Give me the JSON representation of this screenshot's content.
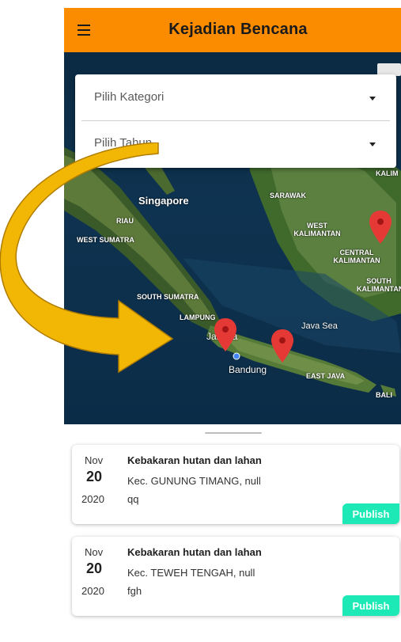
{
  "app": {
    "title": "Kejadian Bencana"
  },
  "filters": {
    "category_label": "Pilih Kategori",
    "year_label": "Pilih Tahun"
  },
  "map": {
    "regions": [
      "SARAWAK",
      "RIAU",
      "WEST SUMATRA",
      "WEST KALIMANTAN",
      "CENTRAL KALIMANTAN",
      "SOUTH KALIMANTAN",
      "SOUTH SUMATRA",
      "LAMPUNG",
      "EAST JAVA",
      "BALI",
      "KALIM"
    ],
    "cities": [
      "Singapore",
      "Jakarta",
      "Bandung",
      "Java Sea"
    ],
    "marker_color": "#e53935"
  },
  "events": [
    {
      "month": "Nov",
      "day": "20",
      "year": "2020",
      "title": "Kebakaran hutan dan lahan",
      "location": "Kec. GUNUNG TIMANG, null",
      "description": "qq",
      "status": "Publish"
    },
    {
      "month": "Nov",
      "day": "20",
      "year": "2020",
      "title": "Kebakaran hutan dan lahan",
      "location": "Kec. TEWEH TENGAH, null",
      "description": "fgh",
      "status": "Publish"
    }
  ],
  "colors": {
    "appbar": "#fb8c00",
    "publish": "#1de9b6",
    "arrow": "#f2b705"
  }
}
